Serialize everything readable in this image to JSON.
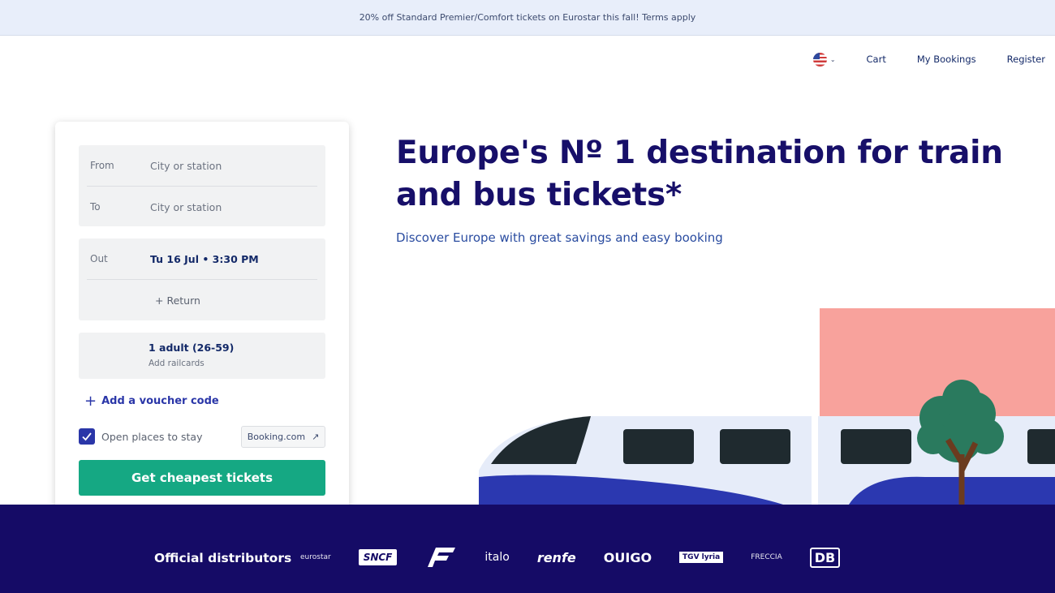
{
  "promo": {
    "text": "20% off Standard Premier/Comfort tickets on Eurostar this fall! Terms apply"
  },
  "nav": {
    "cart": "Cart",
    "bookings": "My Bookings",
    "register": "Register"
  },
  "search": {
    "from_label": "From",
    "from_placeholder": "City or station",
    "to_label": "To",
    "to_placeholder": "City or station",
    "out_label": "Out",
    "out_value": "Tu 16 Jul • 3:30 PM",
    "return_label": "+ Return",
    "passengers": "1 adult (26-59)",
    "railcards": "Add railcards",
    "voucher": "Add a voucher code",
    "stay_label": "Open places to stay",
    "stay_checked": true,
    "booking_partner": "Booking.com",
    "submit": "Get cheapest tickets"
  },
  "hero": {
    "title": "Europe's Nº 1 destination for train and bus tickets*",
    "subtitle": "Discover Europe with great savings and easy booking"
  },
  "distributors": {
    "label": "Official distributors",
    "logos": [
      "eurostar",
      "SNCF",
      "FS",
      "italo",
      "renfe",
      "OUIGO",
      "TGV lyria",
      "FRECCIA",
      "DB"
    ]
  },
  "colors": {
    "primary": "#150b66",
    "cta": "#15a883",
    "accent": "#2a36a8"
  }
}
